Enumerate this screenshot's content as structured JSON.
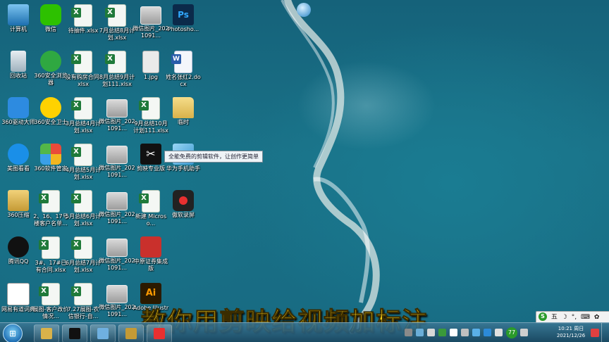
{
  "desktop": {
    "icons": [
      {
        "label": "计算机",
        "type": "pc"
      },
      {
        "label": "回收站",
        "type": "bin"
      },
      {
        "label": "360驱动大师",
        "type": "360drv"
      },
      {
        "label": "美图看看",
        "type": "film"
      },
      {
        "label": "360压缩",
        "type": "rar"
      },
      {
        "label": "腾讯QQ",
        "type": "qq"
      },
      {
        "label": "网易有道词典",
        "type": "news"
      },
      {
        "label": "微信",
        "type": "wechat"
      },
      {
        "label": "360安全浏览器",
        "type": "360br"
      },
      {
        "label": "360安全卫士",
        "type": "360sec"
      },
      {
        "label": "360软件管家",
        "type": "360soft"
      },
      {
        "label": "2、16、17号楼客户名单...",
        "type": "excel"
      },
      {
        "label": "3#、17#已有合同.xlsx",
        "type": "excel"
      },
      {
        "label": "展图-客户改价情况...",
        "type": "excel"
      },
      {
        "label": "待抽件.xlsx",
        "type": "excel"
      },
      {
        "label": "没有购房合同.xlsx",
        "type": "excel"
      },
      {
        "label": "3月总结4月计划.xlsx",
        "type": "excel"
      },
      {
        "label": "4月总结5月计划.xlsx",
        "type": "excel"
      },
      {
        "label": "5月总结6月计划.xlsx",
        "type": "excel"
      },
      {
        "label": "6月总结7月计划.xlsx",
        "type": "excel"
      },
      {
        "label": "7.27展图-农信银行-自...",
        "type": "excel"
      },
      {
        "label": "7月总结8月计划.xlsx",
        "type": "excel"
      },
      {
        "label": "8月总结9月计划111.xlsx",
        "type": "excel"
      },
      {
        "label": "微信图片_2021091...",
        "type": "img"
      },
      {
        "label": "微信图片_2021091...",
        "type": "img"
      },
      {
        "label": "微信图片_2021091...",
        "type": "img"
      },
      {
        "label": "微信图片_2021091...",
        "type": "img"
      },
      {
        "label": "微信图片_2021091...",
        "type": "img"
      },
      {
        "label": "微信图片_2021091...",
        "type": "img"
      },
      {
        "label": "1.jpg",
        "type": "jpg"
      },
      {
        "label": "9月总结10月计划111.xlsx",
        "type": "excel"
      },
      {
        "label": "剪映专业版",
        "type": "capcut"
      },
      {
        "label": "新建 Microso...",
        "type": "excel"
      },
      {
        "label": "中原证券集成版",
        "type": "stock"
      },
      {
        "label": "Adobe Illustrator",
        "type": "ai"
      },
      {
        "label": "Photosho...",
        "type": "ps"
      },
      {
        "label": "姓名张红2.docx",
        "type": "word"
      },
      {
        "label": "临时",
        "type": "folder"
      },
      {
        "label": "华为手机助手",
        "type": "huawei"
      },
      {
        "label": "傲软录屏",
        "type": "rec"
      }
    ],
    "tooltip": "全能免费的剪辑软件，让创作更简单",
    "caption": "教你用剪映给视频加标注"
  },
  "taskbar": {
    "start_label": "开始",
    "clock_time": "10:21 周日",
    "clock_date": "2021/12/26",
    "tray_badge": "77",
    "ime_label": "五",
    "pinned": [
      {
        "name": "explorer",
        "color": "#d9b24a"
      },
      {
        "name": "capcut",
        "color": "#111111"
      },
      {
        "name": "paint",
        "color": "#6fb0e0"
      },
      {
        "name": "winrar",
        "color": "#c49a35"
      },
      {
        "name": "recorder",
        "color": "#e83030"
      }
    ]
  },
  "colors": {
    "caption": "#ffd51a",
    "sea": "#1a7288",
    "excel": "#1f7a3a",
    "word": "#2a5caa"
  }
}
